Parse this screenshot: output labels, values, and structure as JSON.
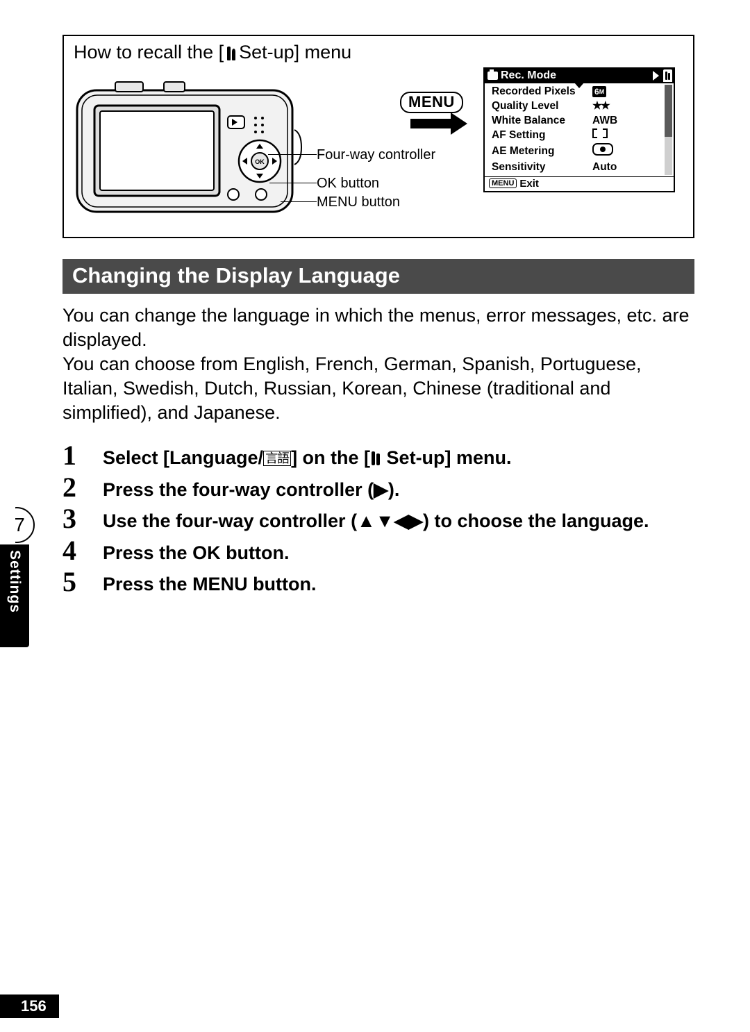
{
  "recall": {
    "title_pre": "How to recall the [",
    "title_post": " Set-up] menu",
    "labels": {
      "fourway": "Four-way controller",
      "ok": "OK button",
      "menu": "MENU button"
    },
    "menu_badge": "MENU"
  },
  "screen": {
    "header": "Rec. Mode",
    "rows": [
      {
        "k": "Recorded Pixels",
        "v_type": "badge6m",
        "v": "6",
        "v2": "M"
      },
      {
        "k": "Quality Level",
        "v_type": "stars",
        "v": "★★"
      },
      {
        "k": "White Balance",
        "v_type": "text",
        "v": "AWB"
      },
      {
        "k": "AF Setting",
        "v_type": "af"
      },
      {
        "k": "AE Metering",
        "v_type": "ae"
      },
      {
        "k": "Sensitivity",
        "v_type": "text",
        "v": "Auto"
      }
    ],
    "footer_chip": "MENU",
    "footer_text": "Exit"
  },
  "section_title": "Changing the Display Language",
  "intro": "You can change the language in which the menus, error messages, etc. are displayed.\nYou can choose from English, French, German, Spanish, Portuguese, Italian, Swedish, Dutch, Russian, Korean, Chinese (traditional and simplified), and Japanese.",
  "steps": [
    {
      "n": "1",
      "pre": "Select [Language/",
      "glyph": "言語",
      "mid": "] on the [",
      "post": " Set-up] menu.",
      "tools_after_mid": true
    },
    {
      "n": "2",
      "text": "Press the four-way controller (▶)."
    },
    {
      "n": "3",
      "text": "Use the four-way controller (▲▼◀▶) to choose the language."
    },
    {
      "n": "4",
      "text": "Press the OK button."
    },
    {
      "n": "5",
      "text": "Press the MENU button."
    }
  ],
  "side": {
    "circle": "7",
    "label": "Settings"
  },
  "page_number": "156"
}
